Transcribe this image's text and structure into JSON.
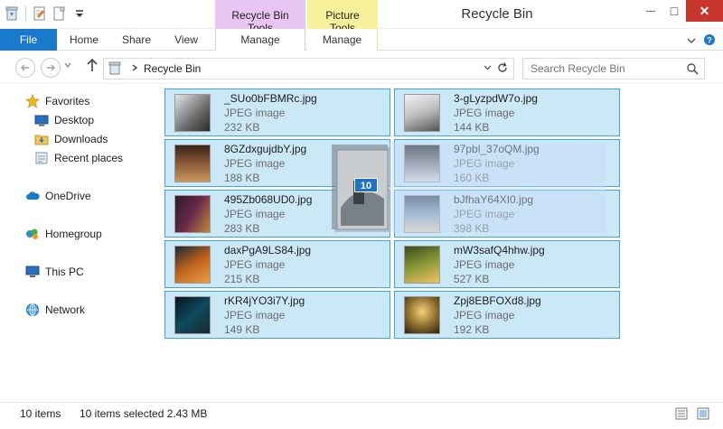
{
  "window": {
    "title": "Recycle Bin",
    "close_glyph": "✕",
    "max_glyph": "□",
    "min_glyph": "—"
  },
  "context_tabs": {
    "recycle_bin_tools": "Recycle Bin Tools",
    "picture_tools": "Picture Tools"
  },
  "ribbon": {
    "tabs": [
      "File",
      "Home",
      "Share",
      "View",
      "Manage",
      "Manage"
    ]
  },
  "address": {
    "location": "Recycle Bin",
    "search_placeholder": "Search Recycle Bin"
  },
  "nav": {
    "favorites": "Favorites",
    "desktop": "Desktop",
    "downloads": "Downloads",
    "recent": "Recent places",
    "onedrive": "OneDrive",
    "homegroup": "Homegroup",
    "thispc": "This PC",
    "network": "Network"
  },
  "files": [
    {
      "name": "_SUo0bFBMRc.jpg",
      "type": "JPEG image",
      "size": "232 KB"
    },
    {
      "name": "3-gLyzpdW7o.jpg",
      "type": "JPEG image",
      "size": "144 KB"
    },
    {
      "name": "8GZdxgujdbY.jpg",
      "type": "JPEG image",
      "size": "188 KB"
    },
    {
      "name": "97pbl_37oQM.jpg",
      "type": "JPEG image",
      "size": "160 KB"
    },
    {
      "name": "495Zb068UD0.jpg",
      "type": "JPEG image",
      "size": "283 KB"
    },
    {
      "name": "bJfhaY64XI0.jpg",
      "type": "JPEG image",
      "size": "398 KB"
    },
    {
      "name": "daxPgA9LS84.jpg",
      "type": "JPEG image",
      "size": "215 KB"
    },
    {
      "name": "mW3safQ4hhw.jpg",
      "type": "JPEG image",
      "size": "527 KB"
    },
    {
      "name": "rKR4jYO3i7Y.jpg",
      "type": "JPEG image",
      "size": "149 KB"
    },
    {
      "name": "Zpj8EBFOXd8.jpg",
      "type": "JPEG image",
      "size": "192 KB"
    }
  ],
  "drag": {
    "count": "10"
  },
  "status": {
    "item_count": "10 items",
    "selection": "10 items selected  2.43 MB"
  },
  "colors": {
    "accent": "#1979ca",
    "selection_fill": "#cbe8f6",
    "selection_border": "#3fa6d8",
    "recycle_tools": "#e8c5f2",
    "picture_tools": "#f6f19a",
    "close_button": "#c7352c"
  },
  "icons": {
    "qat": [
      "recycle-bin-icon",
      "properties-icon",
      "new-folder-icon",
      "customize-dropdown-icon"
    ],
    "nav": [
      "star-icon",
      "desktop-icon",
      "downloads-folder-icon",
      "recent-places-icon",
      "cloud-icon",
      "homegroup-icon",
      "computer-icon",
      "network-icon"
    ]
  }
}
